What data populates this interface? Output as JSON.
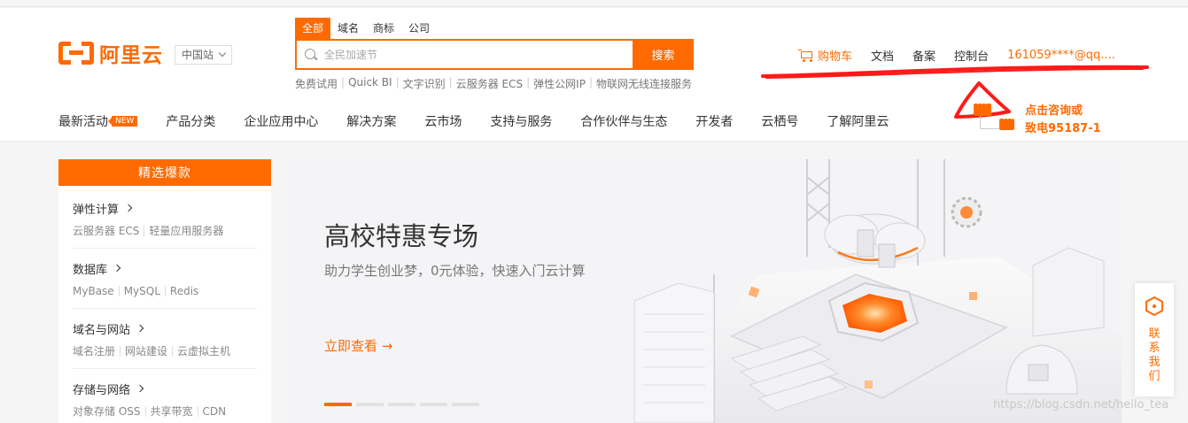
{
  "header": {
    "logo_text": "阿里云",
    "region": "中国站",
    "search": {
      "tabs": [
        "全部",
        "域名",
        "商标",
        "公司"
      ],
      "placeholder": "全民加速节",
      "button": "搜索",
      "hot_words": [
        "免费试用",
        "Quick BI",
        "文字识别",
        "云服务器 ECS",
        "弹性公网IP",
        "物联网无线连接服务"
      ]
    },
    "toplinks": {
      "cart": "购物车",
      "docs": "文档",
      "beian": "备案",
      "console": "控制台",
      "account": "161059****@qq...."
    },
    "nav": {
      "items": [
        "最新活动",
        "产品分类",
        "企业应用中心",
        "解决方案",
        "云市场",
        "支持与服务",
        "合作伙伴与生态",
        "开发者",
        "云栖号",
        "了解阿里云"
      ],
      "new_badge": "NEW"
    },
    "consult": {
      "line1": "点击咨询或",
      "line2": "致电95187-1"
    }
  },
  "left_menu": {
    "title": "精选爆款",
    "sections": [
      {
        "title": "弹性计算",
        "items": [
          "云服务器 ECS",
          "轻量应用服务器"
        ]
      },
      {
        "title": "数据库",
        "items": [
          "MyBase",
          "MySQL",
          "Redis"
        ]
      },
      {
        "title": "域名与网站",
        "items": [
          "域名注册",
          "网站建设",
          "云虚拟主机"
        ]
      },
      {
        "title": "存储与网络",
        "items": [
          "对象存储 OSS",
          "共享带宽",
          "CDN"
        ]
      }
    ]
  },
  "banner": {
    "title": "高校特惠专场",
    "subtitle": "助力学生创业梦，0元体验，快速入门云计算",
    "link": "立即查看",
    "link_arrow": "→",
    "active_slide": 1,
    "slide_count": 5
  },
  "contact": {
    "label": "联系我们"
  },
  "watermark": "https://blog.csdn.net/hello_tea",
  "colors": {
    "accent": "#ff6a00",
    "annotation_red": "#ff1a1a"
  }
}
